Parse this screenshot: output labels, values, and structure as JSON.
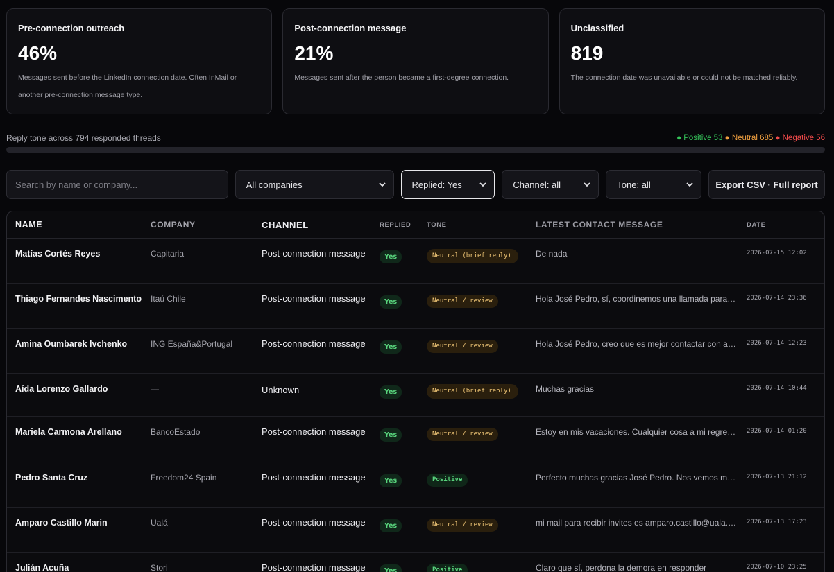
{
  "cards": [
    {
      "title": "Pre-connection outreach",
      "value": "46%",
      "desc": "Messages sent before the LinkedIn connection date. Often InMail or another pre-connection message type."
    },
    {
      "title": "Post-connection message",
      "value": "21%",
      "desc": "Messages sent after the person became a first-degree connection."
    },
    {
      "title": "Unclassified",
      "value": "819",
      "desc": "The connection date was unavailable or could not be matched reliably."
    }
  ],
  "tone": {
    "label": "Reply tone across 794 responded threads",
    "positive": "● Positive 53",
    "neutral": "● Neutral 685",
    "negative": "● Negative 56"
  },
  "filters": {
    "search_placeholder": "Search by name or company...",
    "companies": "All companies",
    "replied": "Replied: Yes",
    "channel": "Channel: all",
    "tone": "Tone: all",
    "export": "Export CSV · Full report"
  },
  "columns": [
    "Name",
    "Company",
    "Channel",
    "Replied",
    "Tone",
    "Latest contact message",
    "Date"
  ],
  "rows": [
    {
      "name": "Matías Cortés Reyes",
      "company": "Capitaria",
      "channel": "Post-connection message",
      "replied": "Yes",
      "tone": "Neutral (brief reply)",
      "tone_kind": "neutral wide",
      "message": "De nada",
      "date": "2026-07-15 12:02",
      "h": 65
    },
    {
      "name": "Thiago Fernandes Nascimento",
      "company": "Itaú Chile",
      "channel": "Post-connection message",
      "replied": "Yes",
      "tone": "Neutral / review",
      "tone_kind": "neutral",
      "message": "Hola José Pedro, sí, coordinemos una llamada para la próxima semana",
      "date": "2026-07-14 23:36",
      "h": 65
    },
    {
      "name": "Amina Oumbarek Ivchenko",
      "company": "ING España&Portugal",
      "channel": "Post-connection message",
      "replied": "Yes",
      "tone": "Neutral / review",
      "tone_kind": "neutral",
      "message": "Hola José Pedro, creo que es mejor contactar con alguien del equipo",
      "date": "2026-07-14 12:23",
      "h": 65
    },
    {
      "name": "Aída Lorenzo Gallardo",
      "company": "—",
      "channel": "Unknown",
      "replied": "Yes",
      "tone": "Neutral (brief reply)",
      "tone_kind": "neutral wide",
      "message": "Muchas gracias",
      "date": "2026-07-14 10:44",
      "h": 62
    },
    {
      "name": "Mariela Carmona Arellano",
      "company": "BancoEstado",
      "channel": "Post-connection message",
      "replied": "Yes",
      "tone": "Neutral / review",
      "tone_kind": "neutral",
      "message": "Estoy en mis vacaciones. Cualquier cosa a mi regreso te escribo",
      "date": "2026-07-14 01:20",
      "h": 66
    },
    {
      "name": "Pedro Santa Cruz",
      "company": "Freedom24 Spain",
      "channel": "Post-connection message",
      "replied": "Yes",
      "tone": "Positive",
      "tone_kind": "positive",
      "message": "Perfecto muchas gracias José Pedro. Nos vemos mañana entonces",
      "date": "2026-07-13 21:12",
      "h": 65
    },
    {
      "name": "Amparo Castillo Marin",
      "company": "Ualá",
      "channel": "Post-connection message",
      "replied": "Yes",
      "tone": "Neutral / review",
      "tone_kind": "neutral",
      "message": "mi mail para recibir invites es amparo.castillo@uala.com.ar",
      "date": "2026-07-13 17:23",
      "h": 65
    },
    {
      "name": "Julián Acuña",
      "company": "Stori",
      "channel": "Post-connection message",
      "replied": "Yes",
      "tone": "Positive",
      "tone_kind": "positive",
      "message": "Claro que sí, perdona la demora en responder",
      "date": "2026-07-10 23:25",
      "h": 65
    }
  ]
}
